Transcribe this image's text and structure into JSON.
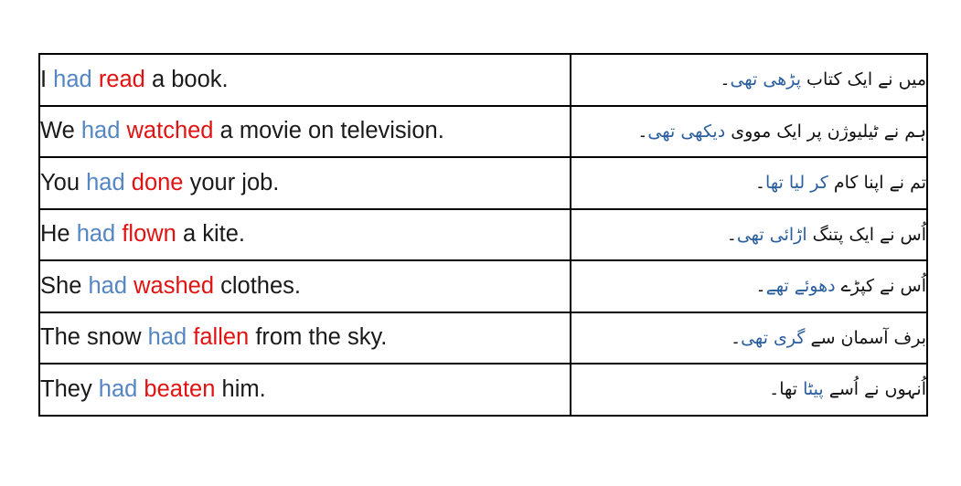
{
  "colors": {
    "auxiliary_blue": "#5586c4",
    "verb_red": "#e11212",
    "urdu_highlight_blue": "#2a5e9e",
    "text_black": "#1a1a1a",
    "border": "#000000",
    "background": "#ffffff"
  },
  "table": {
    "columns": [
      "english",
      "urdu"
    ],
    "rows": [
      {
        "english": {
          "subject": "I ",
          "auxiliary": "had",
          "verb": "read",
          "rest": " a book."
        },
        "urdu": {
          "lead": "میں نے ایک کتاب ",
          "highlight": "پڑھی تھی",
          "tail": "۔"
        }
      },
      {
        "english": {
          "subject": "We ",
          "auxiliary": "had",
          "verb": "watched",
          "rest": " a movie on television."
        },
        "urdu": {
          "lead": "ہم نے ٹیلیوژن پر ایک مووی ",
          "highlight": "دیکھی تھی",
          "tail": "۔"
        }
      },
      {
        "english": {
          "subject": "You ",
          "auxiliary": "had",
          "verb": "done",
          "rest": " your job."
        },
        "urdu": {
          "lead": "تم نے اپنا کام ",
          "highlight": "کر لیا تھا",
          "tail": "۔"
        }
      },
      {
        "english": {
          "subject": "He ",
          "auxiliary": "had",
          "verb": "flown",
          "rest": " a kite."
        },
        "urdu": {
          "lead": "اُس نے ایک پتنگ ",
          "highlight": "اڑائی تھی",
          "tail": "۔"
        }
      },
      {
        "english": {
          "subject": "She ",
          "auxiliary": "had",
          "verb": "washed",
          "rest": " clothes."
        },
        "urdu": {
          "lead": "اُس نے کپڑے ",
          "highlight": "دھوئے تھے",
          "tail": "۔"
        }
      },
      {
        "english": {
          "subject": "The snow ",
          "auxiliary": "had",
          "verb": "fallen",
          "rest": " from the sky."
        },
        "urdu": {
          "lead": "برف آسمان سے ",
          "highlight": "گری تھی",
          "tail": "۔"
        }
      },
      {
        "english": {
          "subject": "They ",
          "auxiliary": "had",
          "verb": "beaten",
          "rest": " him."
        },
        "urdu": {
          "lead": "اُنہوں نے اُسے ",
          "highlight": "پیٹا",
          "tail": " تھا۔"
        }
      }
    ]
  }
}
